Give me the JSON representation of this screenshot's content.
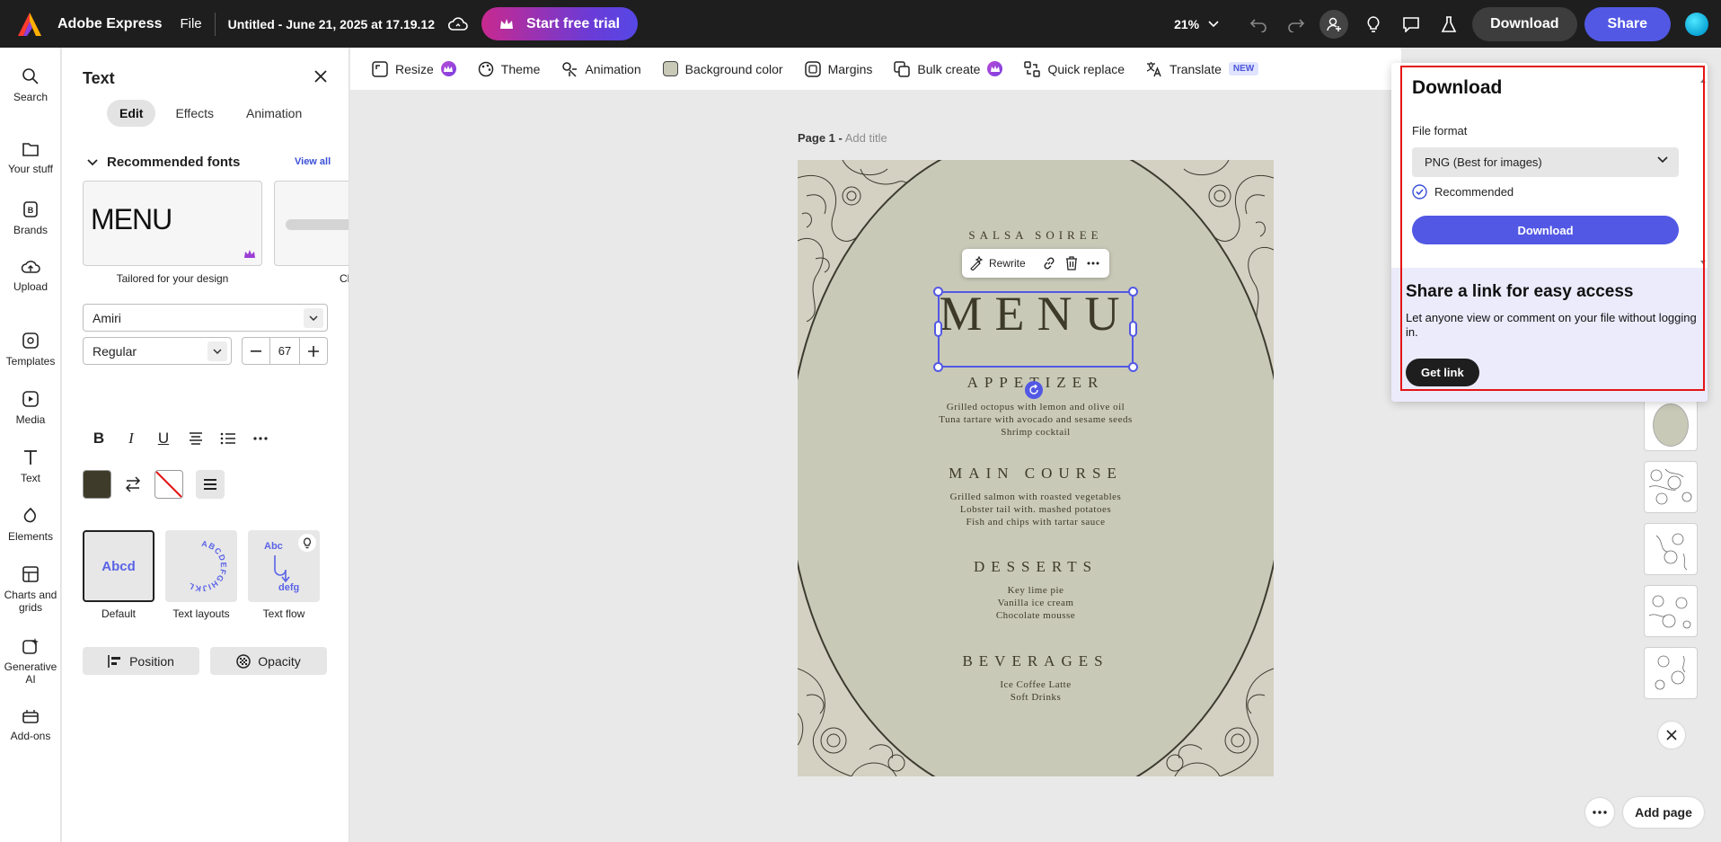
{
  "topbar": {
    "app_name": "Adobe Express",
    "file_menu": "File",
    "doc_title": "Untitled - June 21, 2025 at 17.19.12",
    "trial_button": "Start free trial",
    "zoom": "21%",
    "download_button": "Download",
    "share_button": "Share"
  },
  "rail": {
    "items": [
      {
        "label": "Search",
        "icon": "search-icon"
      },
      {
        "label": "Your stuff",
        "icon": "folder-icon"
      },
      {
        "label": "Brands",
        "icon": "brand-icon"
      },
      {
        "label": "Upload",
        "icon": "upload-icon"
      },
      {
        "label": "Templates",
        "icon": "templates-icon"
      },
      {
        "label": "Media",
        "icon": "media-icon"
      },
      {
        "label": "Text",
        "icon": "text-icon"
      },
      {
        "label": "Elements",
        "icon": "elements-icon"
      },
      {
        "label": "Charts and grids",
        "icon": "charts-icon"
      },
      {
        "label": "Generative AI",
        "icon": "ai-icon"
      },
      {
        "label": "Add-ons",
        "icon": "addons-icon"
      }
    ]
  },
  "panel": {
    "title": "Text",
    "tabs": [
      "Edit",
      "Effects",
      "Animation"
    ],
    "active_tab": "Edit",
    "recommended_heading": "Recommended fonts",
    "view_all": "View all",
    "font_sample": "MENU",
    "font_caption_1": "Tailored for your design",
    "font_caption_2": "Cl",
    "font_family": "Amiri",
    "font_weight": "Regular",
    "font_size": "67",
    "text_color": "#3f3b2a",
    "style_cards": [
      {
        "label": "Default",
        "sample": "Abcd"
      },
      {
        "label": "Text layouts",
        "sample": "ABCDEFGHIJKL"
      },
      {
        "label": "Text flow",
        "sample_top": "Abc",
        "sample_bottom": "defg"
      }
    ],
    "position_button": "Position",
    "opacity_button": "Opacity"
  },
  "context_toolbar": {
    "items": [
      {
        "label": "Resize",
        "icon": "resize-icon",
        "premium": true
      },
      {
        "label": "Theme",
        "icon": "theme-icon"
      },
      {
        "label": "Animation",
        "icon": "animation-icon"
      },
      {
        "label": "Background color",
        "icon": "bg-color-icon"
      },
      {
        "label": "Margins",
        "icon": "margins-icon"
      },
      {
        "label": "Bulk create",
        "icon": "bulk-icon",
        "premium": true
      },
      {
        "label": "Quick replace",
        "icon": "quick-replace-icon"
      },
      {
        "label": "Translate",
        "icon": "translate-icon",
        "badge": "NEW"
      }
    ]
  },
  "canvas": {
    "page_label": "Page 1 -",
    "add_title": "Add title",
    "design": {
      "subtitle": "SALSA SOIREE",
      "title": "MENU",
      "sections": [
        {
          "heading": "APPETIZER",
          "items": [
            "Grilled octopus with lemon and olive oil",
            "Tuna tartare with avocado and sesame seeds",
            "Shrimp cocktail"
          ]
        },
        {
          "heading": "MAIN COURSE",
          "items": [
            "Grilled salmon with roasted vegetables",
            "Lobster tail with. mashed potatoes",
            "Fish and chips with tartar sauce"
          ]
        },
        {
          "heading": "DESSERTS",
          "items": [
            "Key lime pie",
            "Vanilla ice cream",
            "Chocolate mousse"
          ]
        },
        {
          "heading": "BEVERAGES",
          "items": [
            "Ice Coffee Latte",
            "Soft Drinks"
          ]
        }
      ]
    },
    "floating_toolbar": {
      "rewrite": "Rewrite"
    },
    "add_page": "Add page"
  },
  "download_popover": {
    "title": "Download",
    "file_format_label": "File format",
    "file_format_value": "PNG (Best for images)",
    "recommended": "Recommended",
    "download_button": "Download",
    "share_title": "Share a link for easy access",
    "share_desc": "Let anyone view or comment on your file without logging in.",
    "get_link": "Get link"
  },
  "colors": {
    "accent": "#5258e4",
    "topbar": "#1e1e1e",
    "highlight": "#e41414"
  }
}
